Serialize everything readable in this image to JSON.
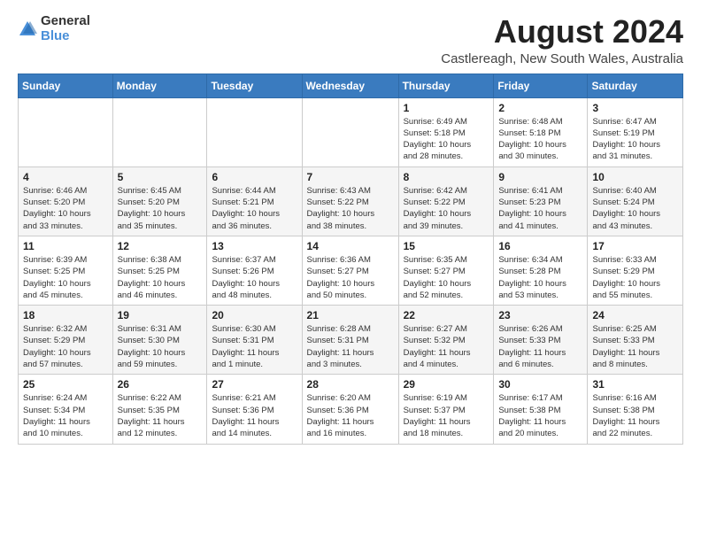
{
  "logo": {
    "text_general": "General",
    "text_blue": "Blue"
  },
  "title": {
    "month": "August 2024",
    "location": "Castlereagh, New South Wales, Australia"
  },
  "calendar": {
    "headers": [
      "Sunday",
      "Monday",
      "Tuesday",
      "Wednesday",
      "Thursday",
      "Friday",
      "Saturday"
    ],
    "weeks": [
      [
        {
          "day": "",
          "info": ""
        },
        {
          "day": "",
          "info": ""
        },
        {
          "day": "",
          "info": ""
        },
        {
          "day": "",
          "info": ""
        },
        {
          "day": "1",
          "info": "Sunrise: 6:49 AM\nSunset: 5:18 PM\nDaylight: 10 hours\nand 28 minutes."
        },
        {
          "day": "2",
          "info": "Sunrise: 6:48 AM\nSunset: 5:18 PM\nDaylight: 10 hours\nand 30 minutes."
        },
        {
          "day": "3",
          "info": "Sunrise: 6:47 AM\nSunset: 5:19 PM\nDaylight: 10 hours\nand 31 minutes."
        }
      ],
      [
        {
          "day": "4",
          "info": "Sunrise: 6:46 AM\nSunset: 5:20 PM\nDaylight: 10 hours\nand 33 minutes."
        },
        {
          "day": "5",
          "info": "Sunrise: 6:45 AM\nSunset: 5:20 PM\nDaylight: 10 hours\nand 35 minutes."
        },
        {
          "day": "6",
          "info": "Sunrise: 6:44 AM\nSunset: 5:21 PM\nDaylight: 10 hours\nand 36 minutes."
        },
        {
          "day": "7",
          "info": "Sunrise: 6:43 AM\nSunset: 5:22 PM\nDaylight: 10 hours\nand 38 minutes."
        },
        {
          "day": "8",
          "info": "Sunrise: 6:42 AM\nSunset: 5:22 PM\nDaylight: 10 hours\nand 39 minutes."
        },
        {
          "day": "9",
          "info": "Sunrise: 6:41 AM\nSunset: 5:23 PM\nDaylight: 10 hours\nand 41 minutes."
        },
        {
          "day": "10",
          "info": "Sunrise: 6:40 AM\nSunset: 5:24 PM\nDaylight: 10 hours\nand 43 minutes."
        }
      ],
      [
        {
          "day": "11",
          "info": "Sunrise: 6:39 AM\nSunset: 5:25 PM\nDaylight: 10 hours\nand 45 minutes."
        },
        {
          "day": "12",
          "info": "Sunrise: 6:38 AM\nSunset: 5:25 PM\nDaylight: 10 hours\nand 46 minutes."
        },
        {
          "day": "13",
          "info": "Sunrise: 6:37 AM\nSunset: 5:26 PM\nDaylight: 10 hours\nand 48 minutes."
        },
        {
          "day": "14",
          "info": "Sunrise: 6:36 AM\nSunset: 5:27 PM\nDaylight: 10 hours\nand 50 minutes."
        },
        {
          "day": "15",
          "info": "Sunrise: 6:35 AM\nSunset: 5:27 PM\nDaylight: 10 hours\nand 52 minutes."
        },
        {
          "day": "16",
          "info": "Sunrise: 6:34 AM\nSunset: 5:28 PM\nDaylight: 10 hours\nand 53 minutes."
        },
        {
          "day": "17",
          "info": "Sunrise: 6:33 AM\nSunset: 5:29 PM\nDaylight: 10 hours\nand 55 minutes."
        }
      ],
      [
        {
          "day": "18",
          "info": "Sunrise: 6:32 AM\nSunset: 5:29 PM\nDaylight: 10 hours\nand 57 minutes."
        },
        {
          "day": "19",
          "info": "Sunrise: 6:31 AM\nSunset: 5:30 PM\nDaylight: 10 hours\nand 59 minutes."
        },
        {
          "day": "20",
          "info": "Sunrise: 6:30 AM\nSunset: 5:31 PM\nDaylight: 11 hours\nand 1 minute."
        },
        {
          "day": "21",
          "info": "Sunrise: 6:28 AM\nSunset: 5:31 PM\nDaylight: 11 hours\nand 3 minutes."
        },
        {
          "day": "22",
          "info": "Sunrise: 6:27 AM\nSunset: 5:32 PM\nDaylight: 11 hours\nand 4 minutes."
        },
        {
          "day": "23",
          "info": "Sunrise: 6:26 AM\nSunset: 5:33 PM\nDaylight: 11 hours\nand 6 minutes."
        },
        {
          "day": "24",
          "info": "Sunrise: 6:25 AM\nSunset: 5:33 PM\nDaylight: 11 hours\nand 8 minutes."
        }
      ],
      [
        {
          "day": "25",
          "info": "Sunrise: 6:24 AM\nSunset: 5:34 PM\nDaylight: 11 hours\nand 10 minutes."
        },
        {
          "day": "26",
          "info": "Sunrise: 6:22 AM\nSunset: 5:35 PM\nDaylight: 11 hours\nand 12 minutes."
        },
        {
          "day": "27",
          "info": "Sunrise: 6:21 AM\nSunset: 5:36 PM\nDaylight: 11 hours\nand 14 minutes."
        },
        {
          "day": "28",
          "info": "Sunrise: 6:20 AM\nSunset: 5:36 PM\nDaylight: 11 hours\nand 16 minutes."
        },
        {
          "day": "29",
          "info": "Sunrise: 6:19 AM\nSunset: 5:37 PM\nDaylight: 11 hours\nand 18 minutes."
        },
        {
          "day": "30",
          "info": "Sunrise: 6:17 AM\nSunset: 5:38 PM\nDaylight: 11 hours\nand 20 minutes."
        },
        {
          "day": "31",
          "info": "Sunrise: 6:16 AM\nSunset: 5:38 PM\nDaylight: 11 hours\nand 22 minutes."
        }
      ]
    ]
  }
}
